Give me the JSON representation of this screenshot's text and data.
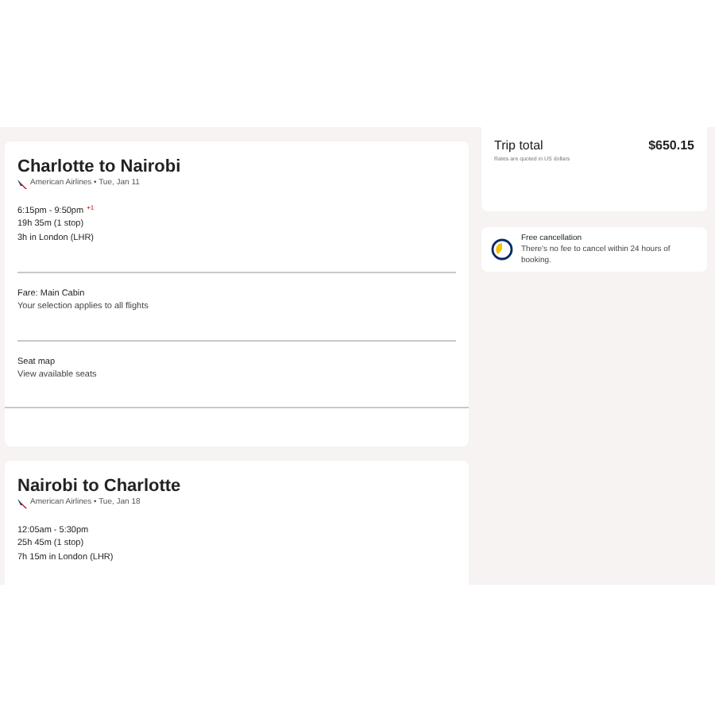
{
  "flights": [
    {
      "title": "Charlotte to Nairobi",
      "airline": "American Airlines • Tue, Jan 11",
      "times": "6:15pm - 9:50pm",
      "day_offset": "+1",
      "duration": "19h 35m (1 stop)",
      "layover": "3h in London (LHR)",
      "sections": [
        {
          "title": "Fare: Main Cabin",
          "detail": "Your selection applies to all flights"
        },
        {
          "title": "Seat map",
          "detail": "View available seats"
        }
      ]
    },
    {
      "title": "Nairobi to Charlotte",
      "airline": "American Airlines • Tue, Jan 18",
      "times": "12:05am - 5:30pm",
      "duration": "25h 45m (1 stop)",
      "layover": "7h 15m in London (LHR)"
    }
  ],
  "trip_total": {
    "label": "Trip total",
    "amount": "$650.15",
    "note": "Rates are quoted in US dollars"
  },
  "cancellation": {
    "title": "Free cancellation",
    "text": "There's no fee to cancel within 24 hours of booking."
  }
}
